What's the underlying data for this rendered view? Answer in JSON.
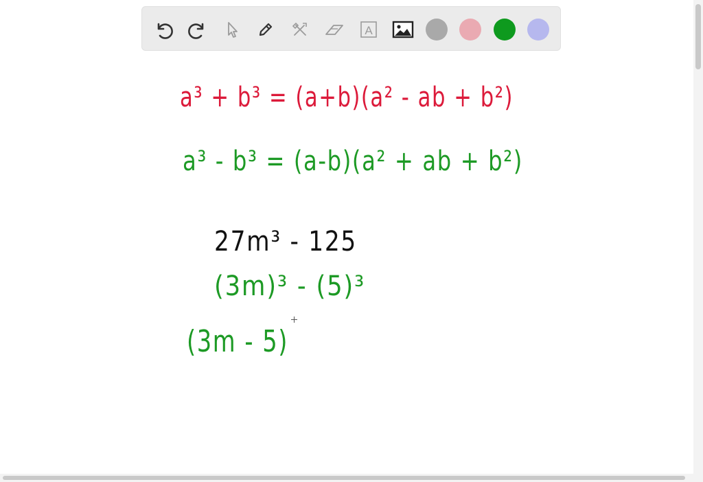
{
  "toolbar": {
    "tools": [
      {
        "name": "undo-icon"
      },
      {
        "name": "redo-icon"
      },
      {
        "name": "select-arrow-icon"
      },
      {
        "name": "pen-icon"
      },
      {
        "name": "tools-icon"
      },
      {
        "name": "eraser-icon"
      },
      {
        "name": "text-icon",
        "label": "A"
      },
      {
        "name": "image-icon"
      }
    ],
    "colors": [
      "#a9a9a9",
      "#eaaab2",
      "#0e9a1e",
      "#b6b8ee"
    ],
    "selected_color": "#0e9a1e"
  },
  "canvas": {
    "ink_colors": {
      "red": "#dc1a3a",
      "green": "#1d9a25",
      "black": "#111111"
    },
    "lines": [
      {
        "text": "a³ + b³ = (a+b)(a² - ab + b²)",
        "color": "red"
      },
      {
        "text": "a³ - b³ = (a-b)(a² + ab + b²)",
        "color": "green"
      },
      {
        "text": "27m³ - 125",
        "color": "black"
      },
      {
        "text": "(3m)³ - (5)³",
        "color": "green"
      },
      {
        "text": "(3m - 5)",
        "color": "green"
      }
    ]
  }
}
